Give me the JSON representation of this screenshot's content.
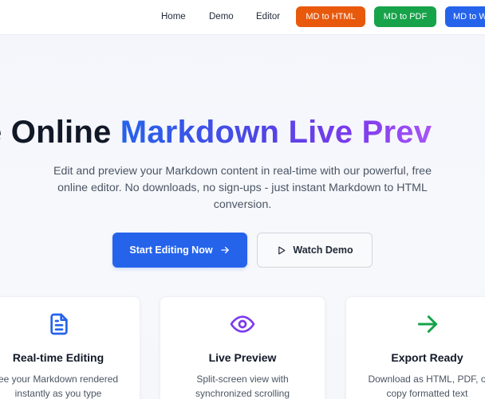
{
  "nav": {
    "links": [
      "Home",
      "Demo",
      "Editor"
    ],
    "buttons": [
      {
        "label": "MD to HTML",
        "color": "#e8590c"
      },
      {
        "label": "MD to PDF",
        "color": "#16a34a"
      },
      {
        "label": "MD to W",
        "color": "#2563eb"
      }
    ]
  },
  "hero": {
    "title_dark": "e Online",
    "title_gradient": "Markdown Live Prev",
    "subtitle_line1": "Edit and preview your Markdown content in real-time with our powerful, free",
    "subtitle_line2": "online editor. No downloads, no sign-ups - just instant Markdown to HTML",
    "subtitle_line3": "conversion.",
    "primary_cta": "Start Editing Now",
    "secondary_cta": "Watch Demo"
  },
  "features": [
    {
      "icon": "document-icon",
      "title": "Real-time Editing",
      "desc_line1": "ee your Markdown rendered",
      "desc_line2": "instantly as you type",
      "color": "#2563eb"
    },
    {
      "icon": "eye-icon",
      "title": "Live Preview",
      "desc_line1": "Split-screen view with",
      "desc_line2": "synchronized scrolling",
      "color": "#7c3aed"
    },
    {
      "icon": "arrow-right-icon",
      "title": "Export Ready",
      "desc_line1": "Download as HTML, PDF, o",
      "desc_line2": "copy formatted text",
      "color": "#16a34a"
    }
  ]
}
